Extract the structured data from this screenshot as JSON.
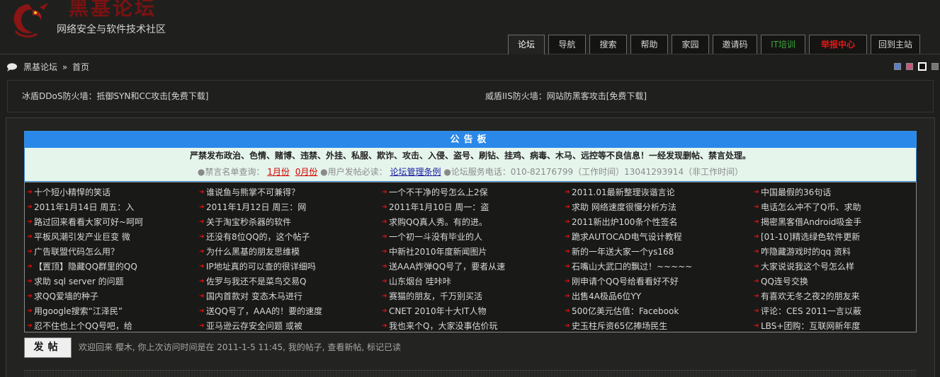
{
  "header": {
    "title": "黑基论坛",
    "subtitle": "网络安全与软件技术社区"
  },
  "nav": {
    "tabs": [
      {
        "label": "论坛",
        "color": "#ffffff",
        "bold": false
      },
      {
        "label": "导航",
        "color": "#d8d8d8",
        "bold": false
      },
      {
        "label": "搜索",
        "color": "#d8d8d8",
        "bold": false
      },
      {
        "label": "帮助",
        "color": "#d8d8d8",
        "bold": false
      },
      {
        "label": "家园",
        "color": "#d8d8d8",
        "bold": false
      },
      {
        "label": "邀请码",
        "color": "#d8d8d8",
        "bold": false
      },
      {
        "label": "IT培训",
        "color": "#3aa83a",
        "bold": false
      },
      {
        "label": "举报中心",
        "color": "#e01818",
        "bold": true
      },
      {
        "label": "回到主站",
        "color": "#d8d8d8",
        "bold": false
      }
    ]
  },
  "breadcrumb": {
    "home": "黑基论坛",
    "separator": "»",
    "current": "首页"
  },
  "style_swatches": [
    "#5b7fc4",
    "#c9577e",
    "#111111",
    "#777777"
  ],
  "ads": {
    "left": "冰盾DDoS防火墙：抵御SYN和CC攻击[免费下载]",
    "right": "威盾IIS防火墙：网站防黑客攻击[免费下载]"
  },
  "notice": {
    "heading": "公告板",
    "rules": "严禁发布政治、色情、赌博、违禁、外挂、私服、欺诈、攻击、入侵、盗号、刷钻、挂鸡、病毒、木马、远控等不良信息！一经发现删帖、禁言处理。",
    "ban_label": "●禁言名单查询：",
    "ban_link1": "1月份",
    "ban_link2": "0月份",
    "guide_label": "●用户发帖必读：",
    "guide_link": "论坛管理条例",
    "phone_text": "●论坛服务电话：010-82176799（工作时间）13041293914（非工作时间）"
  },
  "threads": {
    "col1": [
      "十个短小精悍的笑话",
      "2011年1月14日 周五：入",
      "路过回来看看大家可好~呵呵",
      "平板风潮引发产业巨变 微",
      "广告联盟代码怎么用？",
      "【置顶】隐藏QQ群里的QQ",
      "求助 sql server 的问题",
      "求QQ爱墙的种子",
      "用google搜索“江泽民”",
      "忍不住也上个QQ号吧，给"
    ],
    "col2": [
      "谁说鱼与熊掌不可兼得？",
      "2011年1月12日 周三：网",
      "关于淘宝秒杀器的软件",
      "还没有8位QQ的，这个帖子",
      "为什么黑基的朋友思维模",
      "IP地址真的可以查的很详细吗",
      "佐罗与我还不是菜鸟交易Q",
      "国内首款对 变态木马进行",
      "送QQ号了，AAA的！要的速度",
      "亚马逊云存安全问题 或被"
    ],
    "col3": [
      "一个不干净的号怎么上2保",
      "2011年1月10日 周一：盗",
      "求购QQ真人秀。有的进。",
      "一个初一斗没有毕业的人",
      "中新社2010年度新闻图片",
      "送AAA炸弹QQ号了，要者从速",
      "山东烟台 哇咔咔",
      "赛猫的朋友，千万别买活",
      "CNET 2010年十大IT人物",
      "我也来个Q，大家没事估价玩"
    ],
    "col4": [
      "2011.01最新整理诙谐言论",
      "求助 网络速度很慢分析方法",
      "2011新出炉100条个性签名",
      "跪求AUTOCAD电气设计教程",
      "新的一年送大家一个ys168",
      "石嘴山大武口的飘过！~~~~~",
      "刚申请个QQ号给看看好不好",
      "出售4A极品6位YY",
      "500亿美元估值：Facebook",
      "史玉柱斥资65亿捧场民生"
    ],
    "col5": [
      "中国最假的36句话",
      "电话怎么冲不了Q币、求助",
      "揭密黑客借Android吸金手",
      "[01-10]精选绿色软件更新",
      "咋隐藏游戏时的qq 资料",
      "大家说说我这个号怎么样",
      "QQ连号交换",
      "有喜欢无冬之夜2的朋友来",
      "评论：CES 2011一言以蔽",
      "LBS+团购：互联网新年度"
    ]
  },
  "post_button": "发帖",
  "welcome": "欢迎回来 樱木, 你上次访问时间是在 2011-1-5 11:45, 我的帖子, 查看新帖, 标记已读"
}
